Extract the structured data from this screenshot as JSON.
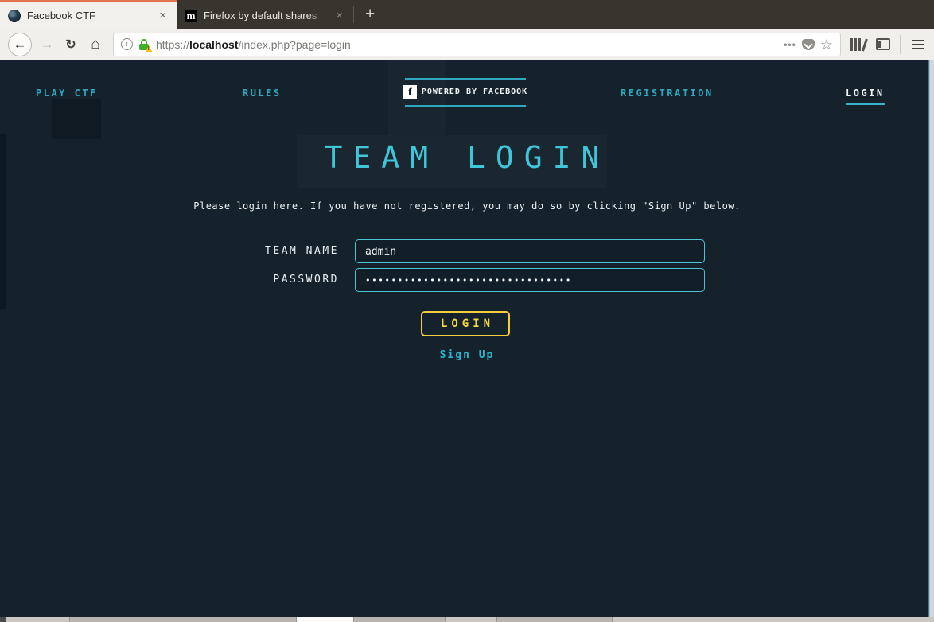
{
  "browser": {
    "tabs": [
      {
        "title": "Facebook CTF",
        "close": "×"
      },
      {
        "title": "Firefox by default shares",
        "close": "×"
      }
    ],
    "new_tab_label": "+",
    "url": {
      "scheme": "https://",
      "host": "localhost",
      "path": "/index.php?page=login"
    },
    "toolbar": {
      "back_glyph": "←",
      "forward_glyph": "→",
      "reload_glyph": "↻",
      "home_glyph": "⌂",
      "info_glyph": "i",
      "overflow_glyph": "•••",
      "star_glyph": "☆"
    }
  },
  "page": {
    "nav": {
      "play_ctf": "PLAY CTF",
      "rules": "RULES",
      "powered_by": "POWERED BY FACEBOOK",
      "fb_glyph": "f",
      "registration": "REGISTRATION",
      "login": "LOGIN"
    },
    "heading": "TEAM LOGIN",
    "description": "Please login here. If you have not registered, you may do so by clicking \"Sign Up\" below.",
    "form": {
      "team_name_label": "TEAM NAME",
      "team_name_value": "admin",
      "password_label": "PASSWORD",
      "password_masked_value": "••••••••••••••••••••••••••••••••",
      "login_button": "LOGIN",
      "signup_link": "Sign Up"
    },
    "colors": {
      "accent_teal": "#2fa8bf",
      "heading_teal": "#3fc6d8",
      "button_yellow": "#f2d03c",
      "background": "#15222c"
    },
    "favicon_m_glyph": "m"
  }
}
